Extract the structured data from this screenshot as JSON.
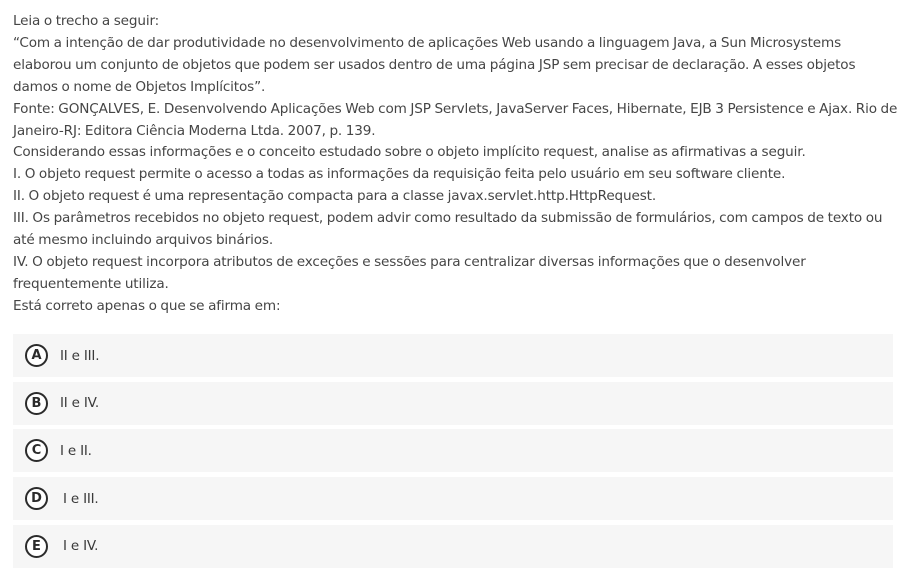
{
  "question": {
    "paragraphs": [
      "Leia o trecho a seguir:",
      "“Com a intenção de dar produtividade no desenvolvimento de aplicações Web usando a linguagem Java, a Sun Microsystems elaborou um conjunto de objetos que podem ser usados dentro de uma página JSP sem precisar de declaração. A esses objetos damos o nome de Objetos Implícitos”.",
      "Fonte: GONÇALVES, E. Desenvolvendo Aplicações Web com JSP Servlets, JavaServer Faces, Hibernate, EJB 3 Persistence e Ajax. Rio de Janeiro-RJ: Editora Ciência Moderna Ltda. 2007, p. 139.",
      "Considerando essas informações e o conceito estudado sobre o objeto implícito request, analise as afirmativas a seguir.",
      "I. O objeto request permite o acesso a todas as informações da requisição feita pelo usuário em seu software cliente.",
      "II. O objeto request é uma representação compacta para a classe javax.servlet.http.HttpRequest.",
      "III. Os parâmetros recebidos no objeto request, podem advir como resultado da submissão de formulários, com campos de texto ou até mesmo incluindo arquivos binários.",
      "IV. O objeto request incorpora atributos de exceções e sessões para centralizar diversas informações que o desenvolver frequentemente utiliza.",
      "Está correto apenas o que se afirma em:"
    ]
  },
  "options": [
    {
      "letter": "A",
      "text": "II e III."
    },
    {
      "letter": "B",
      "text": "II e IV."
    },
    {
      "letter": "C",
      "text": "I e II."
    },
    {
      "letter": "D",
      "text": "I e III."
    },
    {
      "letter": "E",
      "text": "I e IV."
    }
  ]
}
